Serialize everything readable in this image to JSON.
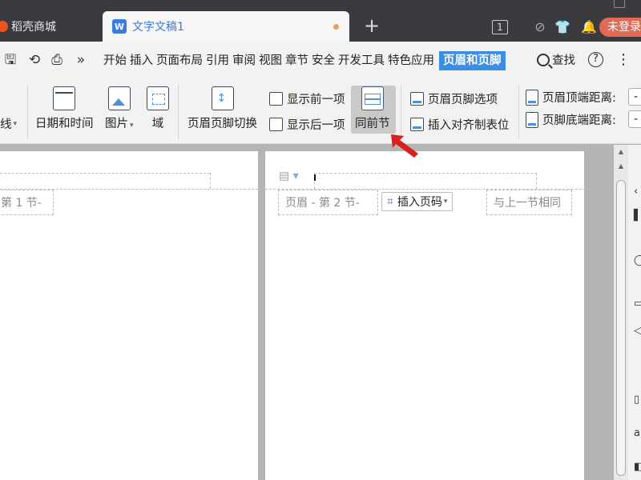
{
  "tabs": {
    "docer": "稻壳商城",
    "doc": "文字文稿1",
    "doc_icon": "W",
    "new_tab": "+",
    "tab_count": "1",
    "login": "未登录"
  },
  "menu": {
    "overflow": "»",
    "items": [
      "开始",
      "插入",
      "页面布局",
      "引用",
      "审阅",
      "视图",
      "章节",
      "安全",
      "开发工具",
      "特色应用"
    ],
    "active": "页眉和页脚",
    "search": "查找",
    "help": "?",
    "more": "⋮"
  },
  "ribbon": {
    "line_label": "线",
    "date_time": "日期和时间",
    "picture": "图片",
    "field": "域",
    "switch": "页眉页脚切换",
    "show_prev": "显示前一项",
    "show_next": "显示后一项",
    "same_as_prev": "同前节",
    "options": "页眉页脚选项",
    "insert_align_tab": "插入对齐制表位",
    "header_top_dist": "页眉顶端距离:",
    "footer_bottom_dist": "页脚底端距离:",
    "dist_value": "-"
  },
  "document": {
    "left_header_label": "第 1 节-",
    "right_header_label": "页眉 - 第 2 节-",
    "insert_page_number": "插入页码",
    "same_as_previous": "与上一节相同"
  },
  "colors": {
    "accent": "#3a8ee6",
    "annotation": "#d9201f",
    "tab_bar": "#3b3b3f",
    "login": "#e06a55"
  }
}
